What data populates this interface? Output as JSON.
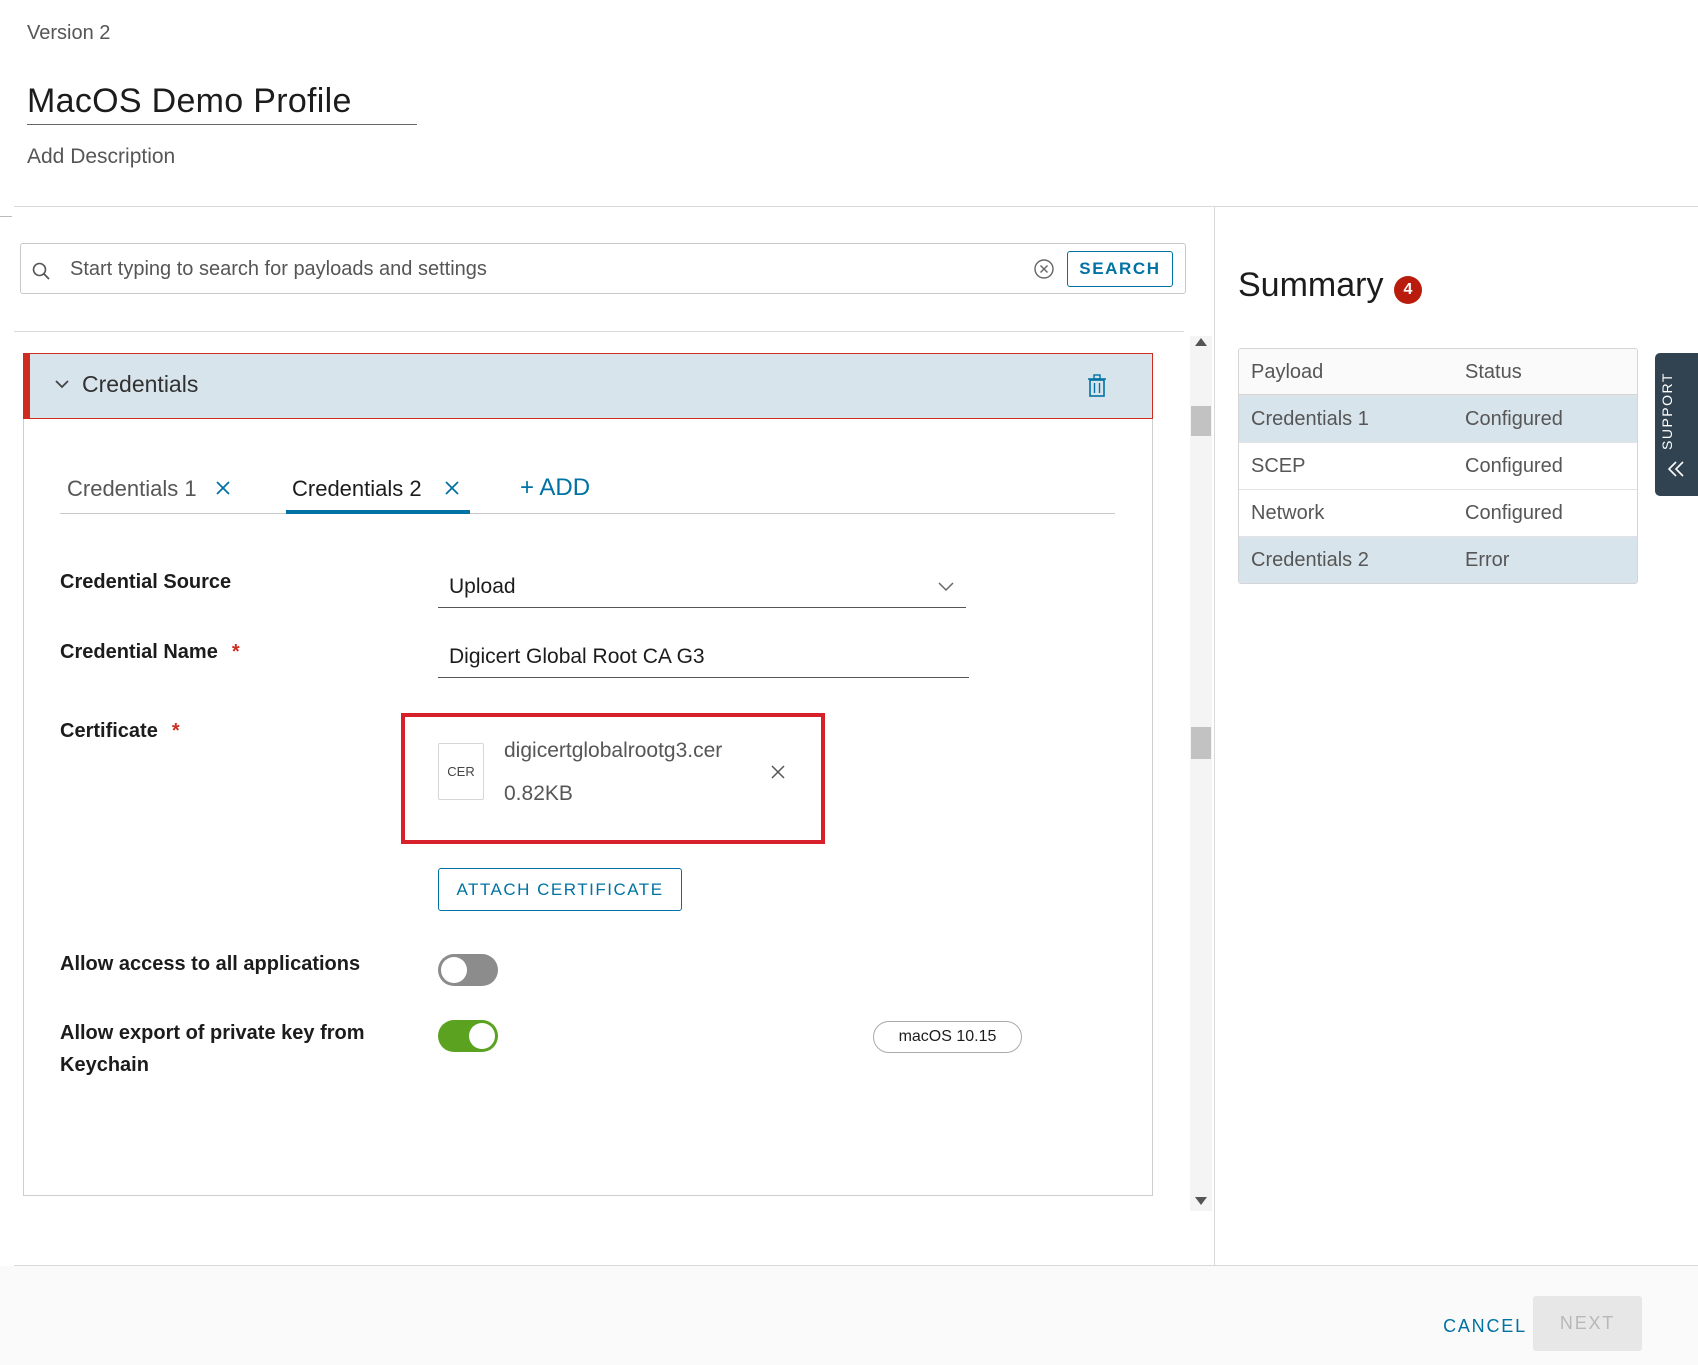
{
  "header": {
    "version": "Version 2",
    "title": "MacOS Demo Profile",
    "add_description": "Add Description"
  },
  "search": {
    "placeholder": "Start typing to search for payloads and settings",
    "value": "",
    "button": "SEARCH"
  },
  "panel": {
    "title": "Credentials",
    "tabs": [
      {
        "label": "Credentials 1",
        "active": false
      },
      {
        "label": "Credentials 2",
        "active": true
      }
    ],
    "add_label": "+ ADD",
    "fields": {
      "source_label": "Credential Source",
      "source_value": "Upload",
      "name_label": "Credential Name",
      "name_value": "Digicert Global Root CA G3",
      "required_mark": "*",
      "cert_label": "Certificate",
      "cert_type": "CER",
      "cert_file": "digicertglobalrootg3.cer",
      "cert_size": "0.82KB",
      "attach_label": "ATTACH CERTIFICATE",
      "allow_access_label": "Allow access to all applications",
      "allow_access_on": false,
      "allow_export_label": "Allow export of private key from Keychain",
      "allow_export_on": true,
      "os_badge": "macOS 10.15"
    }
  },
  "summary": {
    "title": "Summary",
    "count": "4",
    "columns": [
      "Payload",
      "Status"
    ],
    "rows": [
      {
        "payload": "Credentials 1",
        "status": "Configured",
        "highlight": true
      },
      {
        "payload": "SCEP",
        "status": "Configured",
        "highlight": false
      },
      {
        "payload": "Network",
        "status": "Configured",
        "highlight": false
      },
      {
        "payload": "Credentials 2",
        "status": "Error",
        "highlight": true
      }
    ]
  },
  "support": {
    "label": "SUPPORT"
  },
  "footer": {
    "cancel": "CANCEL",
    "next": "NEXT"
  },
  "colors": {
    "accent": "#0072a3",
    "error": "#cf2c20",
    "toggle_on": "#5aa220",
    "header_bg": "#d8e4ec",
    "badge": "#b91c0c"
  }
}
